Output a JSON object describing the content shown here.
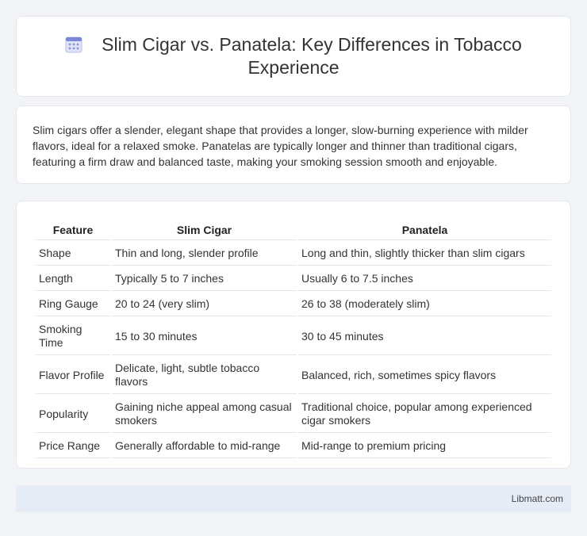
{
  "header": {
    "title": "Slim Cigar vs. Panatela: Key Differences in Tobacco Experience",
    "icon": "calendar-icon"
  },
  "intro": {
    "text": "Slim cigars offer a slender, elegant shape that provides a longer, slow-burning experience with milder flavors, ideal for a relaxed smoke. Panatelas are typically longer and thinner than traditional cigars, featuring a firm draw and balanced taste, making your smoking session smooth and enjoyable."
  },
  "table": {
    "headers": [
      "Feature",
      "Slim Cigar",
      "Panatela"
    ],
    "rows": [
      [
        "Shape",
        "Thin and long, slender profile",
        "Long and thin, slightly thicker than slim cigars"
      ],
      [
        "Length",
        "Typically 5 to 7 inches",
        "Usually 6 to 7.5 inches"
      ],
      [
        "Ring Gauge",
        "20 to 24 (very slim)",
        "26 to 38 (moderately slim)"
      ],
      [
        "Smoking Time",
        "15 to 30 minutes",
        "30 to 45 minutes"
      ],
      [
        "Flavor Profile",
        "Delicate, light, subtle tobacco flavors",
        "Balanced, rich, sometimes spicy flavors"
      ],
      [
        "Popularity",
        "Gaining niche appeal among casual smokers",
        "Traditional choice, popular among experienced cigar smokers"
      ],
      [
        "Price Range",
        "Generally affordable to mid-range",
        "Mid-range to premium pricing"
      ]
    ]
  },
  "footer": {
    "text": "Libmatt.com"
  }
}
